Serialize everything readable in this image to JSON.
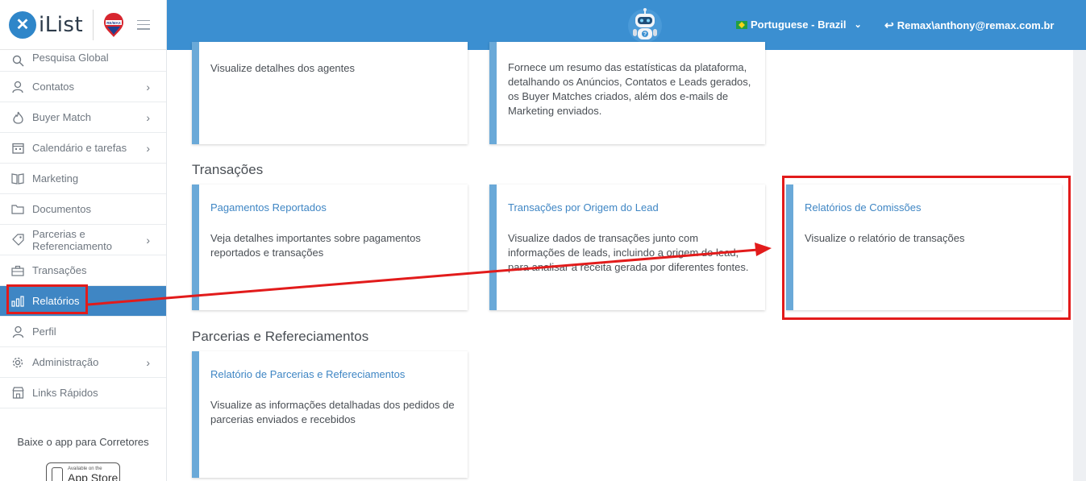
{
  "app": {
    "name": "iList",
    "remax_label": "RE/MAX"
  },
  "header": {
    "language": "Portuguese - Brazil",
    "user": "Remax\\anthony@remax.com.br"
  },
  "sidebar": {
    "items": [
      {
        "label": "Pesquisa Global",
        "icon": "search-icon"
      },
      {
        "label": "Contatos",
        "icon": "contacts-icon"
      },
      {
        "label": "Buyer Match",
        "icon": "flame-icon"
      },
      {
        "label": "Calendário e tarefas",
        "icon": "calendar-icon"
      },
      {
        "label": "Marketing",
        "icon": "book-icon"
      },
      {
        "label": "Documentos",
        "icon": "folder-icon"
      },
      {
        "label": "Parcerias e Referenciamento",
        "icon": "tag-icon"
      },
      {
        "label": "Transações",
        "icon": "briefcase-icon"
      },
      {
        "label": "Relatórios",
        "icon": "bar-chart-icon"
      },
      {
        "label": "Perfil",
        "icon": "user-icon"
      },
      {
        "label": "Administração",
        "icon": "gear-icon"
      },
      {
        "label": "Links Rápidos",
        "icon": "store-icon"
      }
    ],
    "app_promo": "Baixe o app para Corretores",
    "app_store_small": "Available on the",
    "app_store_big": "App Store"
  },
  "main": {
    "top_cards": [
      {
        "desc": "Visualize detalhes dos agentes"
      },
      {
        "desc": "Fornece um resumo das estatísticas da plataforma, detalhando os Anúncios, Contatos e Leads gerados, os Buyer Matches criados, além dos e-mails de Marketing enviados."
      }
    ],
    "sections": [
      {
        "title": "Transações",
        "cards": [
          {
            "title": "Pagamentos Reportados",
            "desc": "Veja detalhes importantes sobre pagamentos reportados e transações"
          },
          {
            "title": "Transações por Origem do Lead",
            "desc": "Visualize dados de transações junto com informações de leads, incluindo a origem do lead, para analisar a receita gerada por diferentes fontes."
          },
          {
            "title": "Relatórios de Comissões",
            "desc": "Visualize o relatório de transações"
          }
        ]
      },
      {
        "title": "Parcerias e Refereciamentos",
        "cards": [
          {
            "title": "Relatório de Parcerias e Refereciamentos",
            "desc": "Visualize as informações detalhadas dos pedidos de parcerias enviados e recebidos"
          }
        ]
      }
    ]
  },
  "colors": {
    "primary": "#3b8fd1",
    "active": "#3f86c4",
    "accent_border": "#6aa9d8",
    "annotation": "#e21b1b"
  }
}
